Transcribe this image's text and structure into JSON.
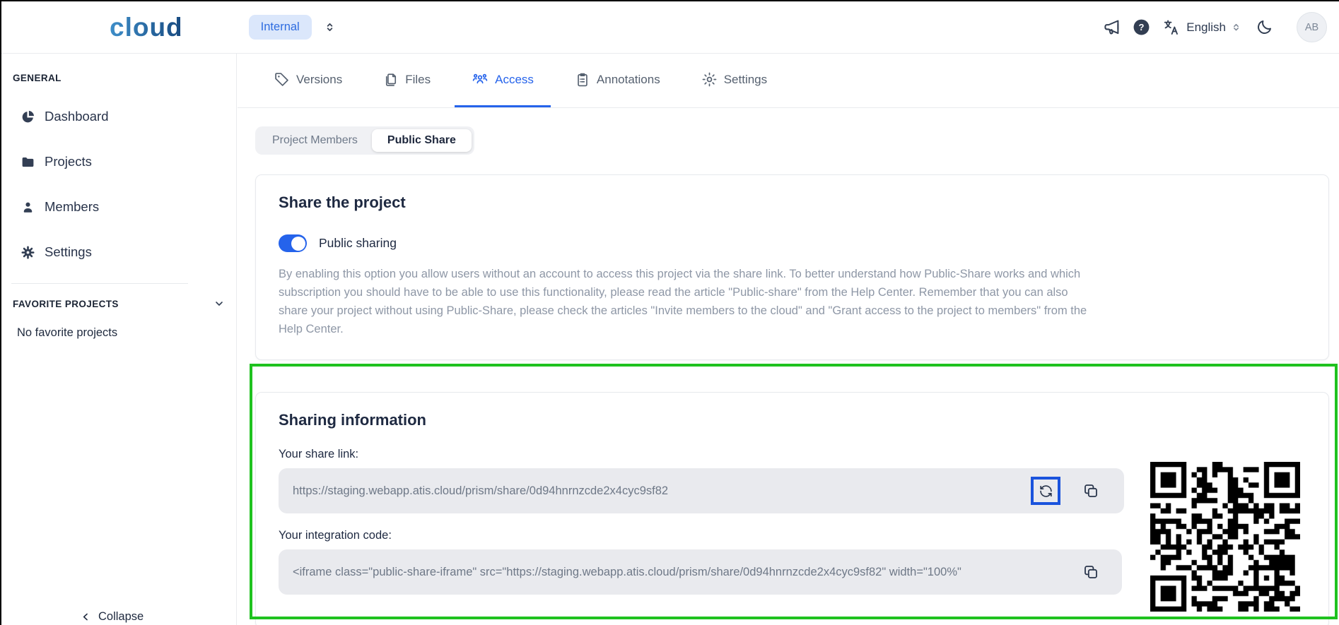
{
  "header": {
    "logo": "cloud",
    "workspace_badge": "Internal",
    "workspace_selector_icon": "sort-chevrons-icon",
    "icons": [
      "megaphone-icon",
      "help-icon",
      "translate-icon",
      "moon-icon"
    ],
    "help_glyph": "?",
    "language": "English",
    "avatar_initials": "AB"
  },
  "sidebar": {
    "general_title": "GENERAL",
    "items": [
      {
        "icon": "pie-chart-icon",
        "label": "Dashboard"
      },
      {
        "icon": "folder-icon",
        "label": "Projects"
      },
      {
        "icon": "person-icon",
        "label": "Members"
      },
      {
        "icon": "gear-icon",
        "label": "Settings"
      }
    ],
    "favorites_title": "FAVORITE PROJECTS",
    "favorites_chevron_icon": "chevron-down-icon",
    "favorites_empty": "No favorite projects",
    "collapse_label": "Collapse",
    "collapse_icon": "chevron-left-icon"
  },
  "tabs": [
    {
      "icon": "tag-icon",
      "label": "Versions",
      "active": false
    },
    {
      "icon": "files-icon",
      "label": "Files",
      "active": false
    },
    {
      "icon": "people-group-icon",
      "label": "Access",
      "active": true
    },
    {
      "icon": "clipboard-icon",
      "label": "Annotations",
      "active": false
    },
    {
      "icon": "gear-outline-icon",
      "label": "Settings",
      "active": false
    }
  ],
  "subtabs": [
    {
      "label": "Project Members",
      "active": false
    },
    {
      "label": "Public Share",
      "active": true
    }
  ],
  "share_card": {
    "title": "Share the project",
    "toggle_label": "Public sharing",
    "toggle_on": true,
    "description": "By enabling this option you allow users without an account to access this project via the share link. To better understand how Public-Share works and which subscription you should have to be able to use this functionality, please read the article \"Public-share\" from the Help Center. Remember that you can also share your project without using Public-Share, please check the articles \"Invite members to the cloud\" and \"Grant access to the project to members\" from the Help Center."
  },
  "sharing_info": {
    "title": "Sharing information",
    "share_link_label": "Your share link:",
    "share_link": "https://staging.webapp.atis.cloud/prism/share/0d94hnrnzcde2x4cyc9sf82",
    "refresh_icon": "refresh-icon",
    "copy_icon": "copy-icon",
    "integration_label": "Your integration code:",
    "integration_code": "<iframe class=\"public-share-iframe\" src=\"https://staging.webapp.atis.cloud/prism/share/0d94hnrnzcde2x4cyc9sf82\" width=\"100%\"",
    "qr_code": "qr-code"
  },
  "annotations": {
    "green_highlight": "#1fc21f",
    "blue_highlight": "#1a53dd"
  },
  "colors": {
    "accent_blue": "#2563eb",
    "badge_bg": "#dbe7fb",
    "input_bg": "#e9eaee",
    "text_dark": "#1e2941",
    "text_gray": "#8e97a6"
  }
}
